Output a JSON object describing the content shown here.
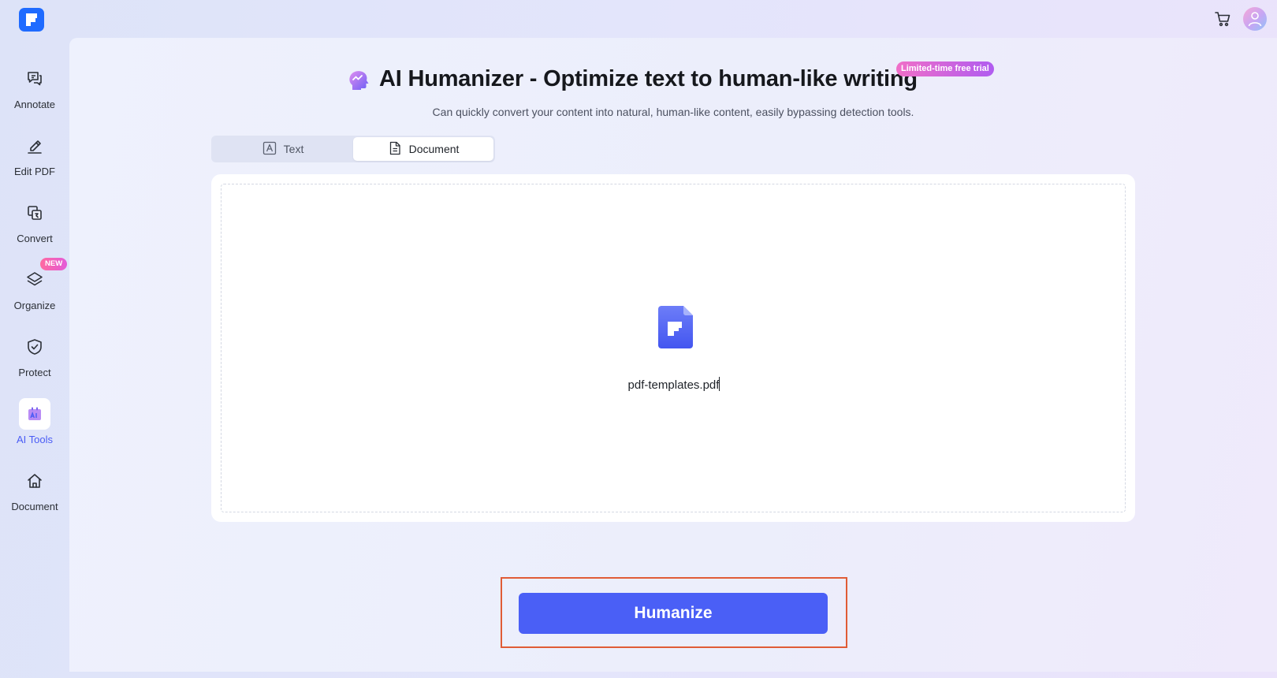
{
  "topbar": {
    "logo_icon": "app-logo-icon",
    "cart_icon": "cart-icon",
    "avatar_icon": "user-avatar-icon"
  },
  "sidebar": {
    "items": [
      {
        "label": "Annotate",
        "icon": "annotate-icon"
      },
      {
        "label": "Edit PDF",
        "icon": "edit-pdf-icon"
      },
      {
        "label": "Convert",
        "icon": "convert-icon"
      },
      {
        "label": "Organize",
        "icon": "layers-icon",
        "badge": "NEW"
      },
      {
        "label": "Protect",
        "icon": "shield-icon"
      },
      {
        "label": "AI Tools",
        "icon": "ai-tools-icon",
        "active": true
      },
      {
        "label": "Document",
        "icon": "home-icon"
      }
    ]
  },
  "main": {
    "title": "AI Humanizer - Optimize text to human-like writing",
    "trial_badge": "Limited-time free trial",
    "subtitle": "Can quickly convert your content into natural, human-like content, easily bypassing detection tools.",
    "tabs": [
      {
        "label": "Text",
        "icon": "text-a-icon",
        "selected": false
      },
      {
        "label": "Document",
        "icon": "document-icon",
        "selected": true
      }
    ],
    "document": {
      "file_name": "pdf-templates.pdf",
      "file_icon": "pdf-file-icon"
    },
    "action_button": "Humanize"
  },
  "colors": {
    "accent": "#4a5ff6",
    "active_nav": "#4a5cf5",
    "highlight_border": "#e05c36",
    "badge_gradient_start": "#f06ec8",
    "badge_gradient_end": "#b05cf0"
  }
}
